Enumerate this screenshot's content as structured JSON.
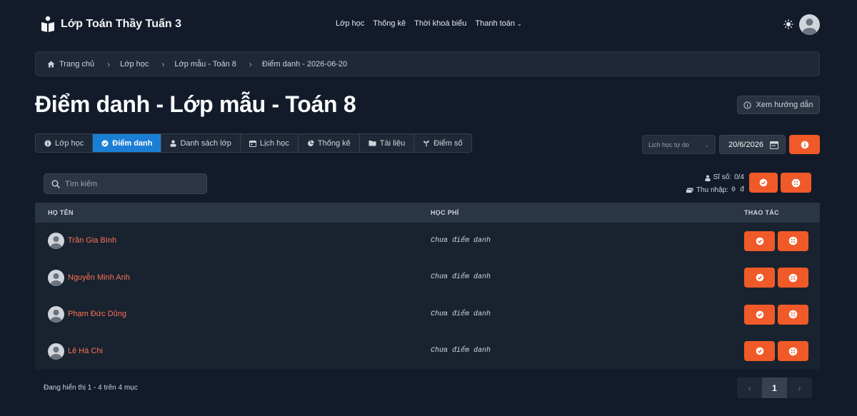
{
  "app": {
    "brand": "Lớp Toán Thầy Tuấn 3",
    "nav": [
      {
        "label": "Lớp học"
      },
      {
        "label": "Thống kê"
      },
      {
        "label": "Thời khoá biểu"
      },
      {
        "label": "Thanh toán"
      }
    ]
  },
  "breadcrumb": [
    "Trang chủ",
    "Lớp học",
    "Lớp mẫu - Toán 8",
    "Điểm danh - 2026-06-20"
  ],
  "page": {
    "title": "Điểm danh - Lớp mẫu - Toán 8",
    "guide_label": "Xem hướng dẫn"
  },
  "tabs": [
    {
      "label": "Lớp học",
      "icon": "info-icon",
      "active": false
    },
    {
      "label": "Điểm danh",
      "icon": "check-circle-icon",
      "active": true
    },
    {
      "label": "Danh sách lớp",
      "icon": "user-icon",
      "active": false
    },
    {
      "label": "Lịch học",
      "icon": "calendar-icon",
      "active": false
    },
    {
      "label": "Thống kê",
      "icon": "pie-chart-icon",
      "active": false
    },
    {
      "label": "Tài liệu",
      "icon": "folder-icon",
      "active": false
    },
    {
      "label": "Điểm số",
      "icon": "seedling-icon",
      "active": false
    }
  ],
  "controls": {
    "schedule_select": "Lịch học tự do",
    "date": "20/6/2026"
  },
  "search": {
    "placeholder": "Tìm kiếm",
    "value": ""
  },
  "stats": {
    "si_so_label": "Sĩ số:",
    "si_so_value": "0/4",
    "thu_nhap_label": "Thu nhập:",
    "thu_nhap_value": "0 đ"
  },
  "table": {
    "headers": {
      "name": "HỌ TÊN",
      "fee": "HỌC PHÍ",
      "actions": "THAO TÁC"
    },
    "rows": [
      {
        "name": "Trần Gia Bình",
        "fee": "Chưa điểm danh"
      },
      {
        "name": "Nguyễn Minh Anh",
        "fee": "Chưa điểm danh"
      },
      {
        "name": "Phạm Đức Dũng",
        "fee": "Chưa điểm danh"
      },
      {
        "name": "Lê Hà Chi",
        "fee": "Chưa điểm danh"
      }
    ]
  },
  "footer": {
    "summary": "Đang hiển thị 1 - 4 trên 4 mục",
    "pager": {
      "prev": "‹",
      "current": "1",
      "next": "›"
    }
  },
  "colors": {
    "accent": "#f05a28",
    "active_tab": "#1a7fd4",
    "name_link": "#f97356",
    "background": "#131b2b"
  }
}
